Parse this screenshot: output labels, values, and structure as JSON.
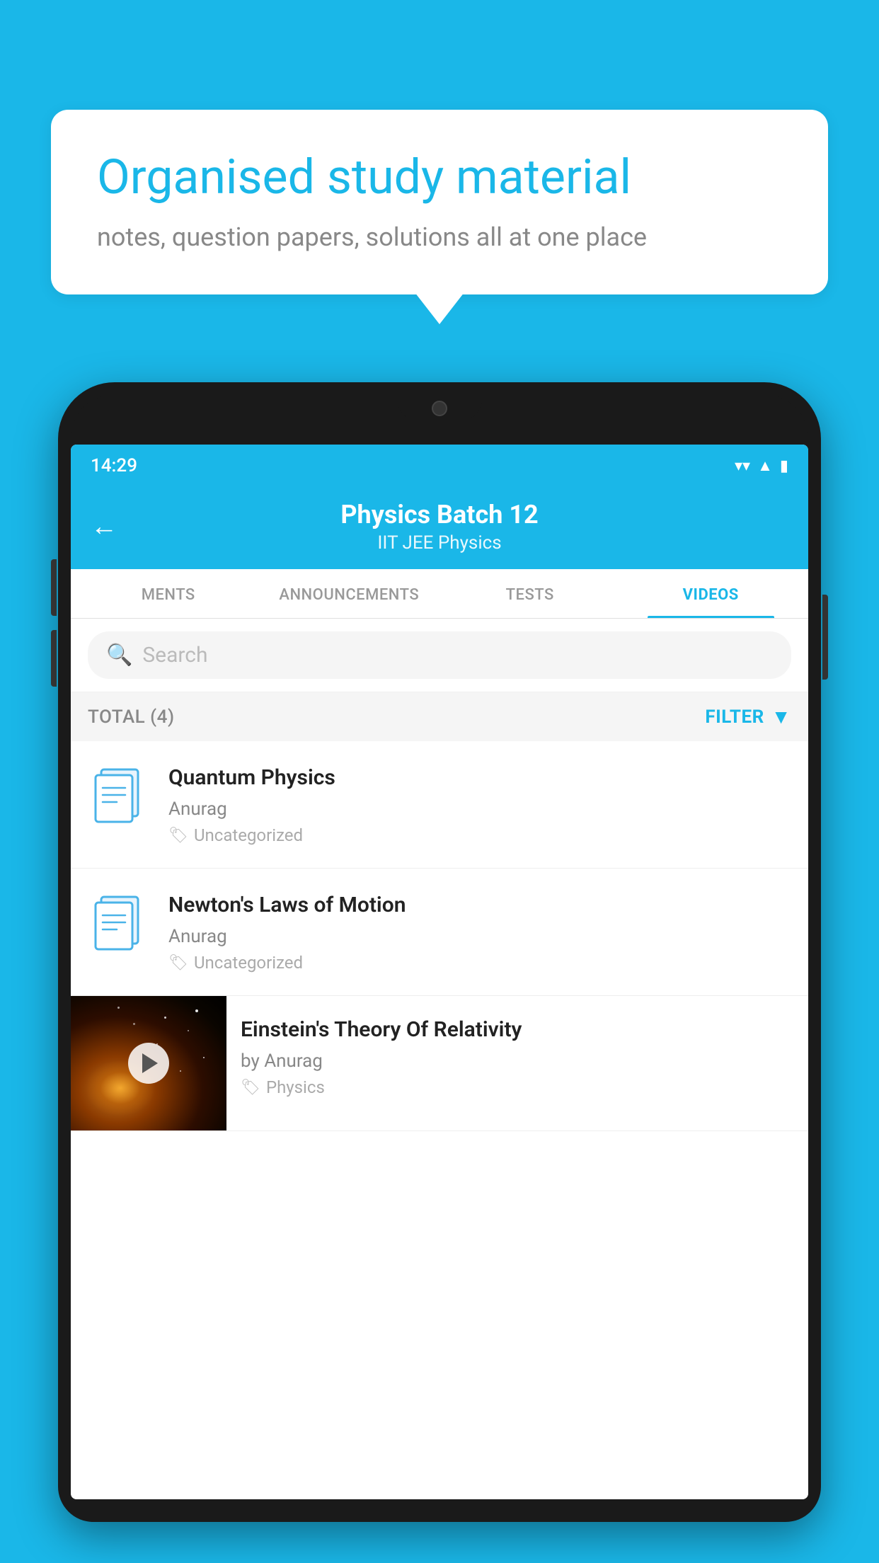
{
  "background_color": "#1ab7e8",
  "speech_bubble": {
    "title": "Organised study material",
    "subtitle": "notes, question papers, solutions all at one place"
  },
  "status_bar": {
    "time": "14:29",
    "icons": [
      "wifi",
      "signal",
      "battery"
    ]
  },
  "app_header": {
    "back_label": "←",
    "title": "Physics Batch 12",
    "subtitle": "IIT JEE   Physics"
  },
  "tabs": [
    {
      "label": "MENTS",
      "active": false
    },
    {
      "label": "ANNOUNCEMENTS",
      "active": false
    },
    {
      "label": "TESTS",
      "active": false
    },
    {
      "label": "VIDEOS",
      "active": true
    }
  ],
  "search": {
    "placeholder": "Search"
  },
  "filter_bar": {
    "total_label": "TOTAL (4)",
    "filter_label": "FILTER"
  },
  "videos": [
    {
      "title": "Quantum Physics",
      "author": "Anurag",
      "tag": "Uncategorized",
      "has_thumbnail": false
    },
    {
      "title": "Newton's Laws of Motion",
      "author": "Anurag",
      "tag": "Uncategorized",
      "has_thumbnail": false
    },
    {
      "title": "Einstein's Theory Of Relativity",
      "author": "by Anurag",
      "tag": "Physics",
      "has_thumbnail": true
    }
  ]
}
